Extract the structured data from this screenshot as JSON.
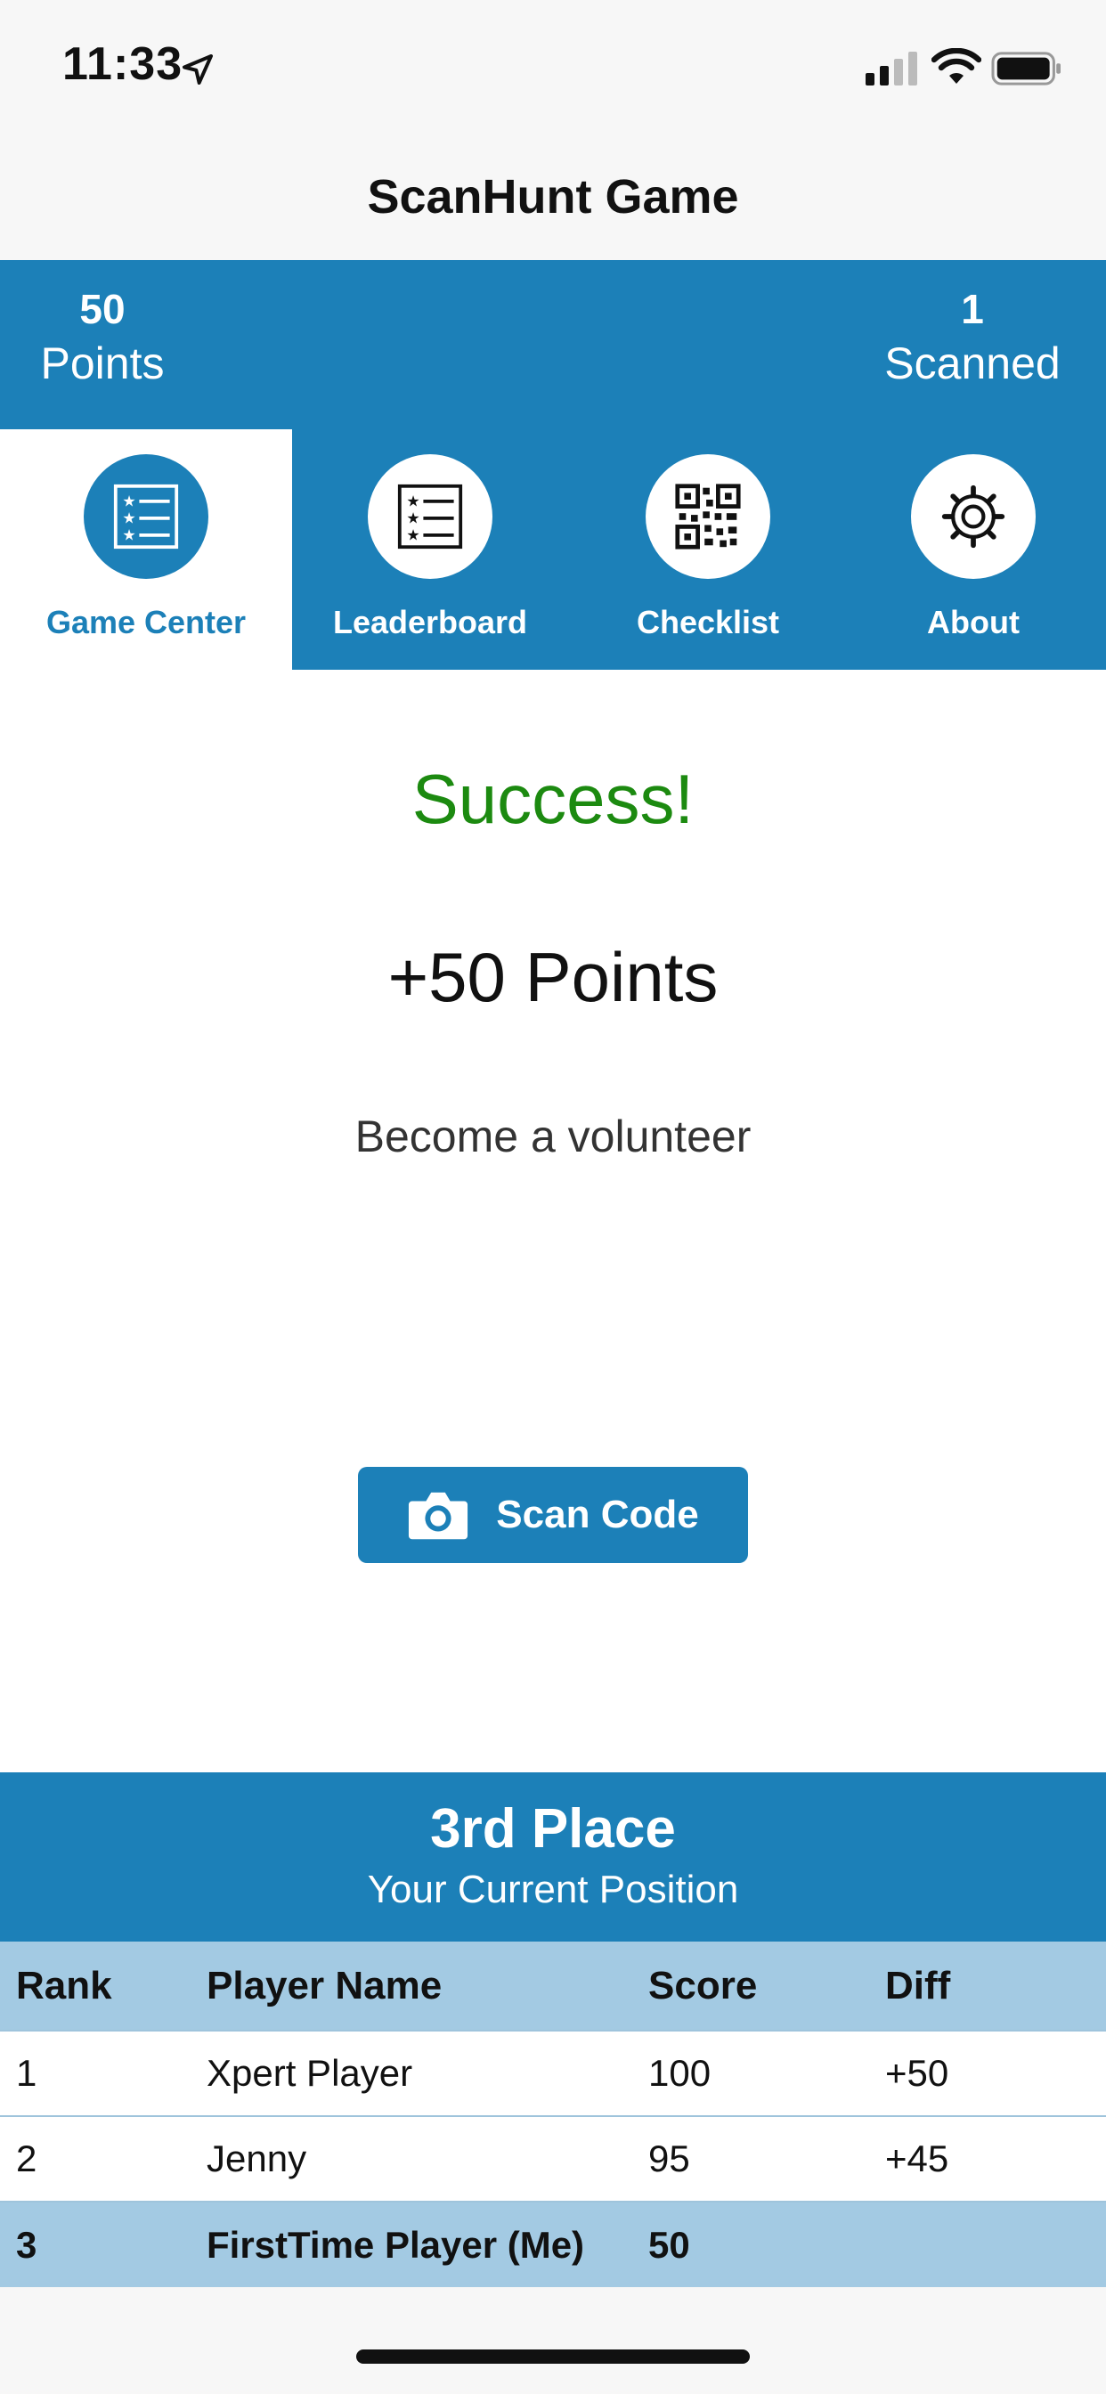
{
  "status_bar": {
    "time": "11:33"
  },
  "nav": {
    "title": "ScanHunt Game"
  },
  "stats": {
    "points_value": "50",
    "points_label": "Points",
    "scanned_value": "1",
    "scanned_label": "Scanned"
  },
  "tabs": [
    {
      "label": "Game Center",
      "icon": "star-list-icon",
      "active": true
    },
    {
      "label": "Leaderboard",
      "icon": "star-list-icon",
      "active": false
    },
    {
      "label": "Checklist",
      "icon": "qr-code-icon",
      "active": false
    },
    {
      "label": "About",
      "icon": "gear-icon",
      "active": false
    }
  ],
  "result": {
    "status": "Success!",
    "points": "+50 Points",
    "message": "Become a volunteer"
  },
  "scan_button": {
    "label": "Scan Code",
    "icon": "camera-icon"
  },
  "position": {
    "title": "3rd Place",
    "subtitle": "Your Current Position"
  },
  "leaderboard": {
    "headers": [
      "Rank",
      "Player Name",
      "Score",
      "Diff"
    ],
    "rows": [
      [
        "1",
        "Xpert Player",
        "100",
        "+50"
      ],
      [
        "2",
        "Jenny",
        "95",
        "+45"
      ],
      [
        "3",
        "FirstTime Player (Me)",
        "50",
        ""
      ]
    ]
  },
  "colors": {
    "primary": "#1c80b8",
    "success": "#1c8a10",
    "table_header": "#a3cae3"
  }
}
